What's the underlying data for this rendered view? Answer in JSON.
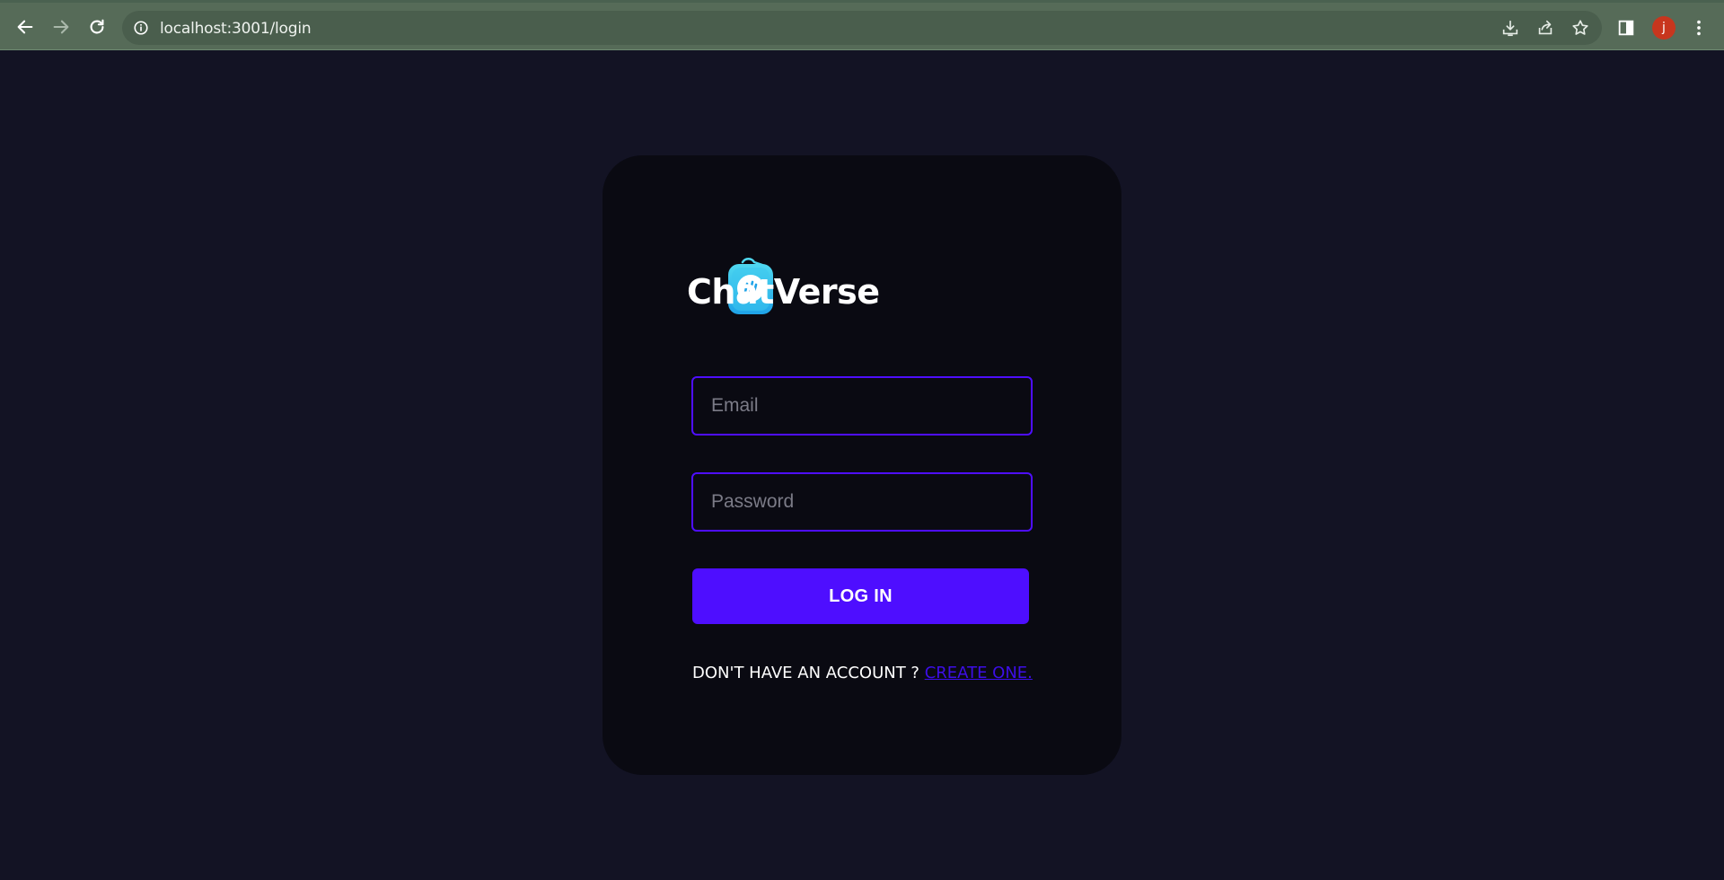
{
  "browser": {
    "url": "localhost:3001/login",
    "profile_initial": "j",
    "icons": {
      "back": "arrow-left-icon",
      "forward": "arrow-right-icon",
      "reload": "reload-icon",
      "site_info": "info-circle-icon",
      "install": "install-app-icon",
      "share": "share-icon",
      "bookmark": "star-icon",
      "side_panel": "side-panel-icon",
      "menu": "kebab-menu-icon"
    },
    "colors": {
      "frame": "#566b58",
      "omnibox": "#4a5e4d",
      "avatar": "#c8361e"
    }
  },
  "login": {
    "brand_name": "ChatVerse",
    "email_placeholder": "Email",
    "password_placeholder": "Password",
    "login_button": "LOG IN",
    "signup_prompt": "DON'T HAVE AN ACCOUNT ? ",
    "signup_link": "CREATE ONE.",
    "colors": {
      "accent": "#4e0eff",
      "card": "#0a0a12",
      "background": "#131324",
      "link": "#3d0ee8"
    }
  }
}
